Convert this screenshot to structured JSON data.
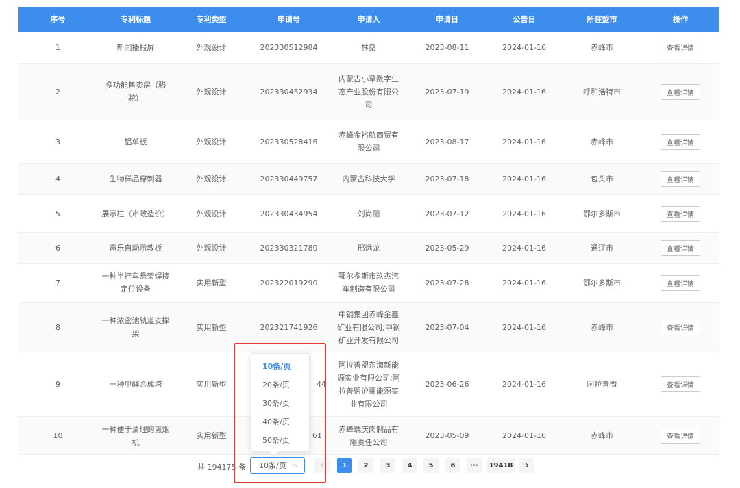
{
  "table": {
    "headers": [
      "序号",
      "专利标题",
      "专利类型",
      "申请号",
      "申请人",
      "申请日",
      "公告日",
      "所在盟市",
      "操作"
    ],
    "rows": [
      {
        "no": "1",
        "title": "新闻播报屏",
        "type": "外观设计",
        "app_no": "202330512984",
        "applicant": "林燊",
        "app_date": "2023-08-11",
        "pub_date": "2024-01-16",
        "city": "赤峰市",
        "action": "查看详情"
      },
      {
        "no": "2",
        "title": "多功能售卖房（骆驼）",
        "type": "外观设计",
        "app_no": "202330452934",
        "applicant": "内蒙古小草数字生态产业股份有限公司",
        "app_date": "2023-07-19",
        "pub_date": "2024-01-16",
        "city": "呼和浩特市",
        "action": "查看详情"
      },
      {
        "no": "3",
        "title": "铝单板",
        "type": "外观设计",
        "app_no": "202330528416",
        "applicant": "赤峰金裕航商贸有限公司",
        "app_date": "2023-08-17",
        "pub_date": "2024-01-16",
        "city": "赤峰市",
        "action": "查看详情"
      },
      {
        "no": "4",
        "title": "生物样品穿刺器",
        "type": "外观设计",
        "app_no": "202330449757",
        "applicant": "内蒙古科技大学",
        "app_date": "2023-07-18",
        "pub_date": "2024-01-16",
        "city": "包头市",
        "action": "查看详情"
      },
      {
        "no": "5",
        "title": "展示栏（市政造价）",
        "type": "外观设计",
        "app_no": "202330434954",
        "applicant": "刘尚丽",
        "app_date": "2023-07-12",
        "pub_date": "2024-01-16",
        "city": "鄂尔多斯市",
        "action": "查看详情"
      },
      {
        "no": "6",
        "title": "声乐自动示教板",
        "type": "外观设计",
        "app_no": "202330321780",
        "applicant": "邢远龙",
        "app_date": "2023-05-29",
        "pub_date": "2024-01-16",
        "city": "通辽市",
        "action": "查看详情"
      },
      {
        "no": "7",
        "title": "一种半挂车悬架焊接定位设备",
        "type": "实用新型",
        "app_no": "202322019290",
        "applicant": "鄂尔多斯市玖杰汽车制造有限公司",
        "app_date": "2023-07-28",
        "pub_date": "2024-01-16",
        "city": "鄂尔多斯市",
        "action": "查看详情"
      },
      {
        "no": "8",
        "title": "一种浓密池轨道支撑架",
        "type": "实用新型",
        "app_no": "202321741926",
        "applicant": "中钢集团赤峰金鑫矿业有限公司;中钢矿业开发有限公司",
        "app_date": "2023-07-04",
        "pub_date": "2024-01-16",
        "city": "赤峰市",
        "action": "查看详情"
      },
      {
        "no": "9",
        "title": "一种甲醇合成塔",
        "type": "实用新型",
        "app_no": "44",
        "applicant": "阿拉善盟东海新能源实业有限公司;阿拉善盟沪蒙能源实业有限公司",
        "app_date": "2023-06-26",
        "pub_date": "2024-01-16",
        "city": "阿拉善盟",
        "action": "查看详情"
      },
      {
        "no": "10",
        "title": "一种便于清理的熏烟机",
        "type": "实用新型",
        "app_no": "61",
        "applicant": "赤峰瑞庆肉制品有限责任公司",
        "app_date": "2023-05-09",
        "pub_date": "2024-01-16",
        "city": "赤峰市",
        "action": "查看详情"
      }
    ]
  },
  "pagination": {
    "total": "共 194175 条",
    "page_size": "10条/页",
    "prev_icon": "chevron-left-icon",
    "next_icon": "chevron-right-icon",
    "pages": [
      "1",
      "2",
      "3",
      "4",
      "5",
      "6"
    ],
    "ellipsis": "···",
    "last_page": "19418",
    "active_page": "1"
  },
  "dropdown": {
    "options": [
      "10条/页",
      "20条/页",
      "30条/页",
      "40条/页",
      "50条/页"
    ],
    "selected": "10条/页"
  },
  "colors": {
    "header_bg": "#3d8ded",
    "accent": "#3d8ded",
    "highlight_border": "#e53935"
  }
}
